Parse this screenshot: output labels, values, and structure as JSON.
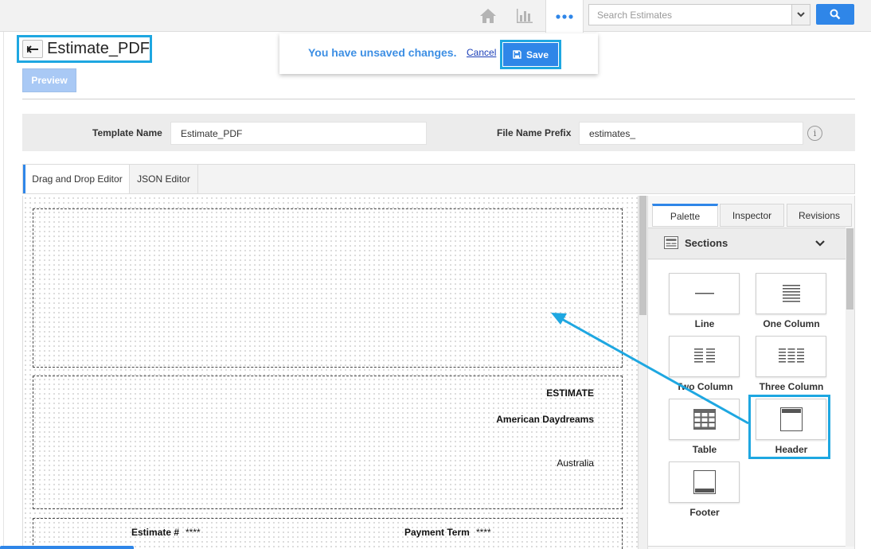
{
  "topbar": {
    "search_placeholder": "Search Estimates",
    "icons": [
      "home-icon",
      "bar-chart-icon",
      "more-dots-icon",
      "chevron-down-icon",
      "search-icon"
    ]
  },
  "page": {
    "title": "Estimate_PDF",
    "preview_label": "Preview"
  },
  "unsaved": {
    "message": "You have unsaved changes.",
    "cancel_label": "Cancel",
    "save_label": "Save"
  },
  "fields": {
    "template_name_label": "Template Name",
    "template_name_value": "Estimate_PDF",
    "file_prefix_label": "File Name Prefix",
    "file_prefix_value": "estimates_",
    "info_glyph": "i"
  },
  "editor_tabs": [
    {
      "label": "Drag and Drop Editor",
      "active": true
    },
    {
      "label": "JSON Editor",
      "active": false
    }
  ],
  "canvas": {
    "estimate_heading": "ESTIMATE",
    "company": "American Daydreams",
    "country": "Australia",
    "estimate_no_label": "Estimate #",
    "estimate_no_value": "****",
    "payment_term_label": "Payment Term",
    "payment_term_value": "****"
  },
  "panel": {
    "tabs": [
      {
        "label": "Palette",
        "active": true
      },
      {
        "label": "Inspector",
        "active": false
      },
      {
        "label": "Revisions",
        "active": false
      }
    ],
    "group_label": "Sections",
    "items": [
      {
        "label": "Line",
        "icon": "line-icon"
      },
      {
        "label": "One Column",
        "icon": "one-column-icon"
      },
      {
        "label": "Two Column",
        "icon": "two-column-icon"
      },
      {
        "label": "Three Column",
        "icon": "three-column-icon"
      },
      {
        "label": "Table",
        "icon": "table-icon"
      },
      {
        "label": "Header",
        "icon": "header-icon"
      },
      {
        "label": "Footer",
        "icon": "footer-icon"
      }
    ]
  },
  "colors": {
    "accent": "#2f86e8",
    "highlight": "#1ea7e1"
  }
}
